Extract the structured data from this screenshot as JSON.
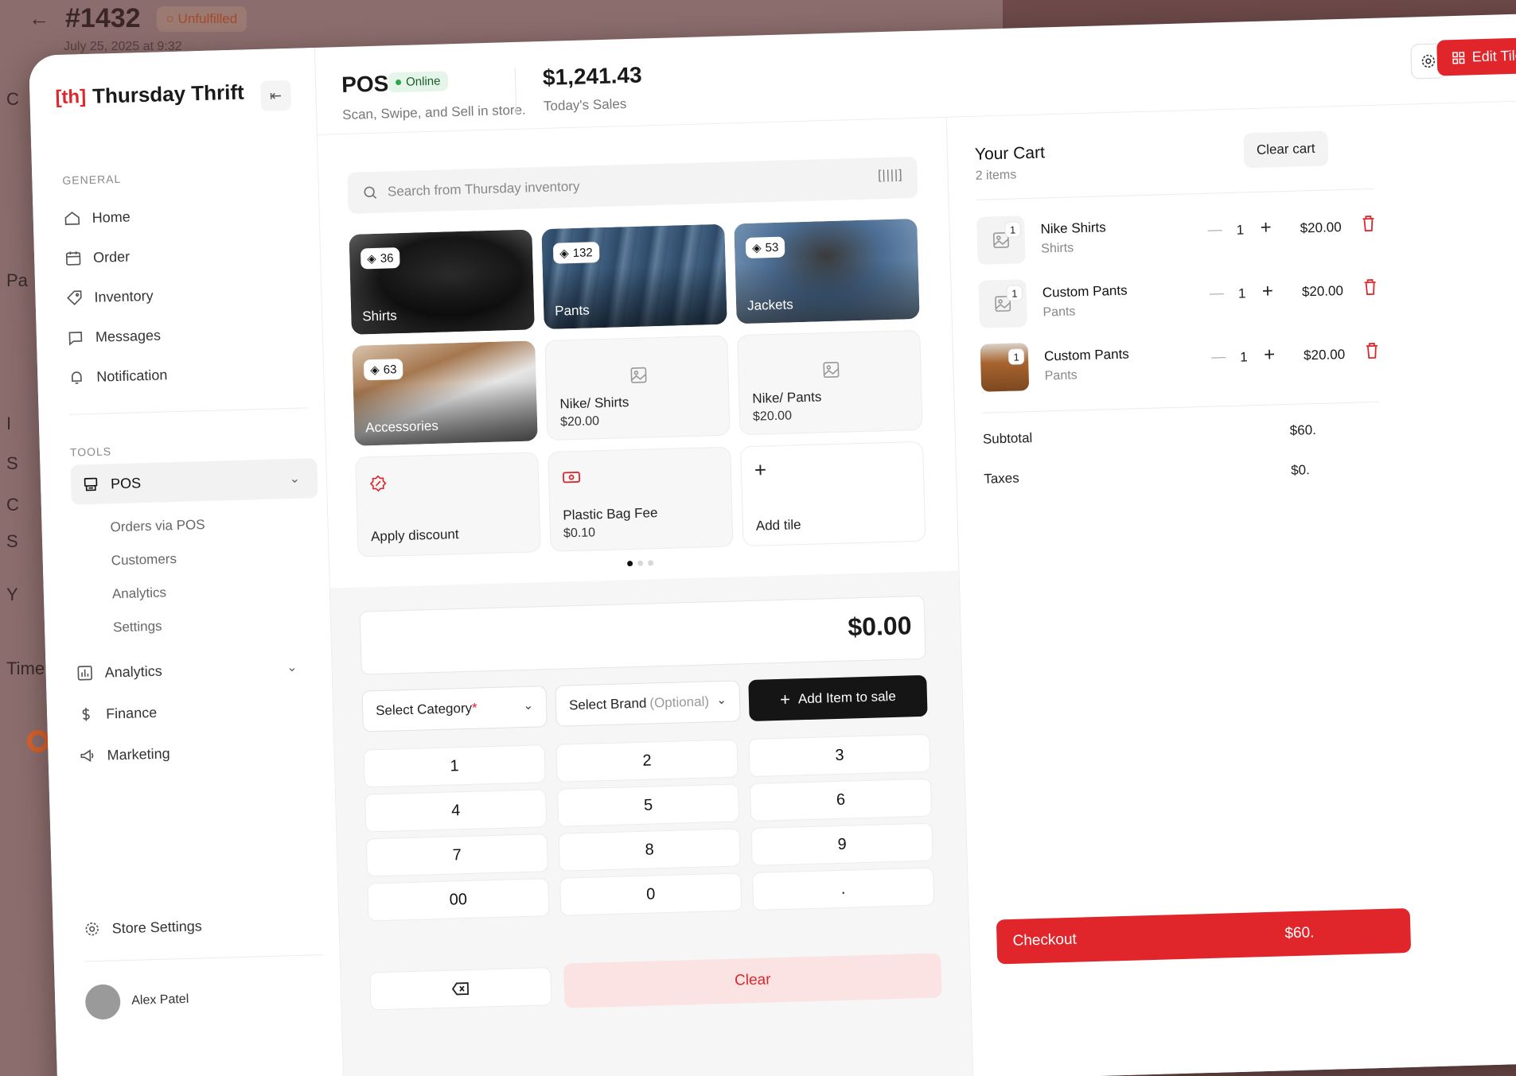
{
  "background": {
    "order_title": "#1432",
    "order_status": "Unfulfilled",
    "order_date": "July 25, 2025 at 9:32",
    "letters": [
      "C",
      "Pa",
      "I",
      "S",
      "C",
      "S",
      "Y",
      "Time"
    ]
  },
  "brand": {
    "mark": "[th]",
    "name": "Thursday Thrift"
  },
  "sidebar": {
    "general_label": "GENERAL",
    "general_items": [
      {
        "label": "Home",
        "icon": "home-icon"
      },
      {
        "label": "Order",
        "icon": "calendar-icon"
      },
      {
        "label": "Inventory",
        "icon": "tag-icon"
      },
      {
        "label": "Messages",
        "icon": "message-icon"
      },
      {
        "label": "Notification",
        "icon": "bell-icon"
      }
    ],
    "tools_label": "TOOLS",
    "pos_label": "POS",
    "pos_sub_items": [
      "Orders via POS",
      "Customers",
      "Analytics",
      "Settings"
    ],
    "tools_items": [
      {
        "label": "Analytics",
        "icon": "chart-icon"
      },
      {
        "label": "Finance",
        "icon": "dollar-icon"
      },
      {
        "label": "Marketing",
        "icon": "megaphone-icon"
      }
    ],
    "store_settings": "Store Settings",
    "user_name": "Alex Patel"
  },
  "header": {
    "title": "POS",
    "status": "Online",
    "subtitle": "Scan, Swipe, and Sell in store.",
    "sales_value": "$1,241.43",
    "sales_label": "Today's Sales",
    "edit_tiles": "Edit Tiles"
  },
  "search": {
    "placeholder": "Search from Thursday inventory"
  },
  "tiles": {
    "categories": [
      {
        "label": "Shirts",
        "count": "36"
      },
      {
        "label": "Pants",
        "count": "132"
      },
      {
        "label": "Jackets",
        "count": "53"
      },
      {
        "label": "Accessories",
        "count": "63"
      }
    ],
    "products": [
      {
        "name": "Nike/ Shirts",
        "price": "$20.00"
      },
      {
        "name": "Nike/ Pants",
        "price": "$20.00"
      }
    ],
    "apply_discount": "Apply discount",
    "bag_fee": {
      "name": "Plastic Bag Fee",
      "price": "$0.10"
    },
    "add_tile": "Add tile"
  },
  "keypad": {
    "amount": "$0.00",
    "category_placeholder": "Select Category",
    "brand_placeholder": "Select Brand",
    "brand_optional": "(Optional)",
    "add_item": "Add Item to sale",
    "keys": [
      "1",
      "2",
      "3",
      "4",
      "5",
      "6",
      "7",
      "8",
      "9",
      "00",
      "0",
      "."
    ],
    "clear": "Clear"
  },
  "cart": {
    "title": "Your Cart",
    "count": "2 items",
    "clear_cart": "Clear cart",
    "items": [
      {
        "name": "Nike Shirts",
        "category": "Shirts",
        "qty": "1",
        "price": "$20.00",
        "badge": "1"
      },
      {
        "name": "Custom Pants",
        "category": "Pants",
        "qty": "1",
        "price": "$20.00",
        "badge": "1"
      },
      {
        "name": "Custom Pants",
        "category": "Pants",
        "qty": "1",
        "price": "$20.00",
        "badge": "1"
      }
    ],
    "subtotal_label": "Subtotal",
    "subtotal_value": "$60.",
    "taxes_label": "Taxes",
    "taxes_value": "$0.",
    "checkout_label": "Checkout",
    "checkout_value": "$60."
  },
  "colors": {
    "accent": "#e0252b",
    "dark": "#151515",
    "online": "#2aa84a"
  }
}
